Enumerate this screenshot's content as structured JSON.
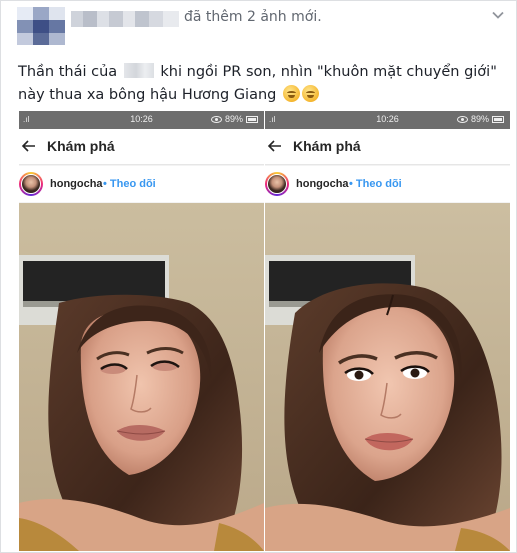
{
  "post": {
    "header_action": "đã thêm 2 ảnh mới.",
    "caption_part1": "Thần thái của ",
    "caption_part2": " khi ngồi PR son, nhìn \"khuôn mặt chuyển giới\" này thua xa bông hậu Hương Giang"
  },
  "screenshots": [
    {
      "status_time": "10:26",
      "battery": "89%",
      "nav_title": "Khám phá",
      "username": "hongocha",
      "follow": "• Theo dõi"
    },
    {
      "status_time": "10:26",
      "battery": "89%",
      "nav_title": "Khám phá",
      "username": "hongocha",
      "follow": "• Theo dõi"
    }
  ],
  "colors": {
    "link_blue": "#3897f0",
    "status_bar": "#6d6d6d",
    "meta_gray": "#616770"
  }
}
